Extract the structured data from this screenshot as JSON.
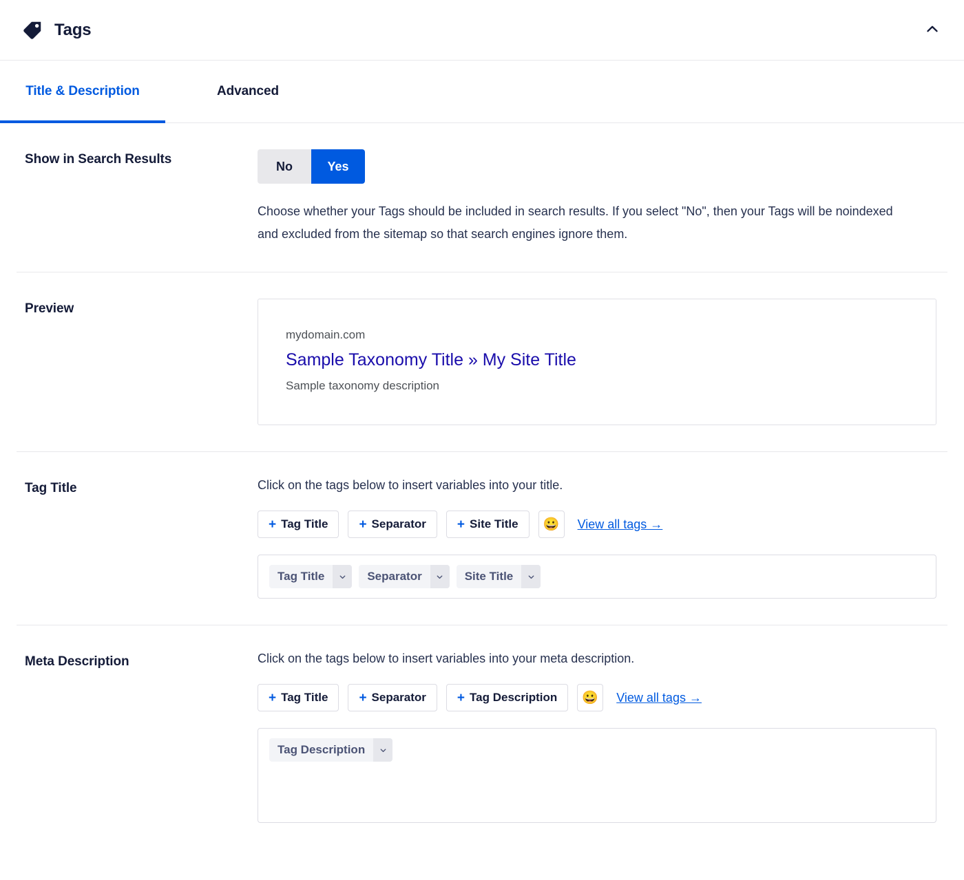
{
  "header": {
    "title": "Tags",
    "icon": "tag-icon",
    "collapse_icon": "chevron-up-icon"
  },
  "tabs": [
    {
      "label": "Title & Description",
      "active": true
    },
    {
      "label": "Advanced",
      "active": false
    }
  ],
  "sections": {
    "search_results": {
      "label": "Show in Search Results",
      "options": [
        {
          "label": "No",
          "selected": false
        },
        {
          "label": "Yes",
          "selected": true
        }
      ],
      "help": "Choose whether your Tags should be included in search results. If you select \"No\", then your Tags will be noindexed and excluded from the sitemap so that search engines ignore them."
    },
    "preview": {
      "label": "Preview",
      "domain": "mydomain.com",
      "title": "Sample Taxonomy Title » My Site Title",
      "description": "Sample taxonomy description"
    },
    "tag_title": {
      "label": "Tag Title",
      "instruction": "Click on the tags below to insert variables into your title.",
      "buttons": [
        {
          "plus": "+",
          "label": "Tag Title"
        },
        {
          "plus": "+",
          "label": "Separator"
        },
        {
          "plus": "+",
          "label": "Site Title"
        }
      ],
      "emoji": "😀",
      "view_all": "View all tags →",
      "tokens": [
        {
          "label": "Tag Title",
          "caret": "⌄"
        },
        {
          "label": "Separator",
          "caret": "⌄"
        },
        {
          "label": "Site Title",
          "caret": "⌄"
        }
      ]
    },
    "meta_description": {
      "label": "Meta Description",
      "instruction": "Click on the tags below to insert variables into your meta description.",
      "buttons": [
        {
          "plus": "+",
          "label": "Tag Title"
        },
        {
          "plus": "+",
          "label": "Separator"
        },
        {
          "plus": "+",
          "label": "Tag Description"
        }
      ],
      "emoji": "😀",
      "view_all": "View all tags →",
      "tokens": [
        {
          "label": "Tag Description",
          "caret": "⌄"
        }
      ]
    }
  },
  "colors": {
    "accent": "#005ae0",
    "text": "#141b38",
    "link_preview": "#1a0dab",
    "chip_bg": "#f3f4f7",
    "border": "#e8e8eb"
  }
}
